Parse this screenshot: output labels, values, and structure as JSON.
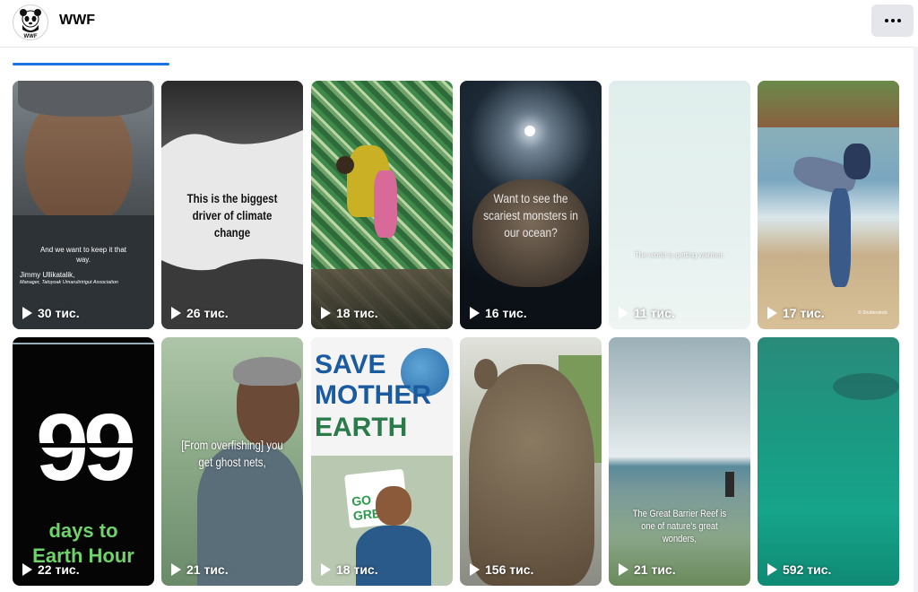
{
  "page": {
    "name": "WWF",
    "logo_text": "WWF"
  },
  "icons": {
    "more": "more-horizontal-icon",
    "play": "play-icon"
  },
  "colors": {
    "accent": "#1b74e4",
    "button_bg": "#e4e6eb"
  },
  "videos": [
    {
      "views": "30 тис.",
      "caption": "And we want to keep it that way.",
      "person_name": "Jimmy Ullikatalik,",
      "person_title": "Manager, Taloyoak Umaruliririgut Association"
    },
    {
      "views": "26 тис.",
      "caption": "This is the biggest driver of climate change"
    },
    {
      "views": "18 тис."
    },
    {
      "views": "16 тис.",
      "caption": "Want to see the scariest monsters in our ocean?"
    },
    {
      "views": "11 тис.",
      "caption": "The world is getting warmer."
    },
    {
      "views": "17 тис.",
      "badge": "© Shutterstock"
    },
    {
      "views": "22 тис.",
      "big_number": "99",
      "caption_line1": "days to",
      "caption_line2": "Earth Hour"
    },
    {
      "views": "21 тис.",
      "caption": "[From overfishing] you get ghost nets,"
    },
    {
      "views": "18 тис.",
      "sign_line1": "SAVE",
      "sign_line2": "MOTHER",
      "sign_line3": "EARTH",
      "sign2": "GO GREEN"
    },
    {
      "views": "156 тис."
    },
    {
      "views": "21 тис.",
      "caption": "The Great Barrier Reef is one of nature's great wonders,"
    },
    {
      "views": "592 тис."
    }
  ]
}
